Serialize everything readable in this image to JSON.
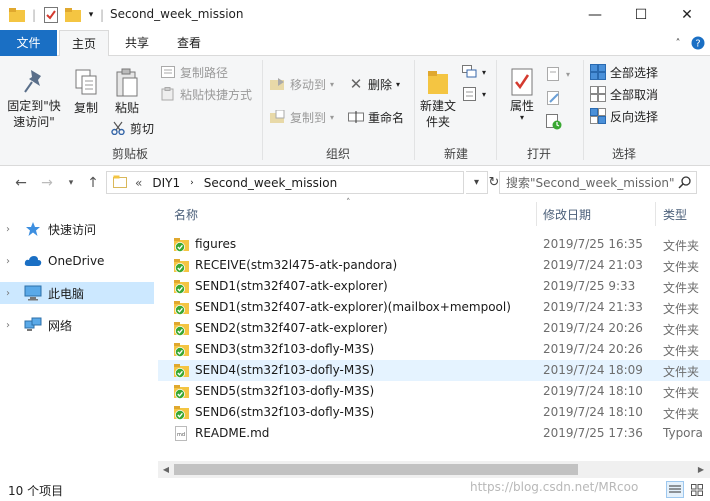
{
  "window": {
    "title": "Second_week_mission",
    "minimize": "—",
    "maximize": "☐",
    "close": "✕"
  },
  "tabs": {
    "file": "文件",
    "home": "主页",
    "share": "共享",
    "view": "查看"
  },
  "ribbon": {
    "clipboard": {
      "label": "剪贴板",
      "pin": "固定到\"快速访问\"",
      "copy": "复制",
      "paste": "粘贴",
      "copy_path": "复制路径",
      "paste_shortcut": "粘贴快捷方式",
      "cut": "剪切"
    },
    "organize": {
      "label": "组织",
      "move_to": "移动到",
      "copy_to": "复制到",
      "delete": "删除",
      "rename": "重命名"
    },
    "new": {
      "label": "新建",
      "new_folder": "新建文件夹"
    },
    "open": {
      "label": "打开",
      "properties": "属性"
    },
    "select": {
      "label": "选择",
      "select_all": "全部选择",
      "select_none": "全部取消",
      "invert": "反向选择"
    }
  },
  "address": {
    "prefix": "«",
    "segments": [
      "DIY1",
      "Second_week_mission"
    ],
    "search_placeholder": "搜索\"Second_week_mission\""
  },
  "nav": {
    "items": [
      {
        "label": "快速访问",
        "icon": "star-icon"
      },
      {
        "label": "OneDrive",
        "icon": "cloud-icon"
      },
      {
        "label": "此电脑",
        "icon": "computer-icon",
        "selected": true
      },
      {
        "label": "网络",
        "icon": "network-icon"
      }
    ]
  },
  "columns": {
    "name": "名称",
    "date": "修改日期",
    "type": "类型"
  },
  "files": [
    {
      "name": "figures",
      "date": "2019/7/25 16:35",
      "type": "文件夹",
      "kind": "folder"
    },
    {
      "name": "RECEIVE(stm32l475-atk-pandora)",
      "date": "2019/7/24 21:03",
      "type": "文件夹",
      "kind": "folder"
    },
    {
      "name": "SEND1(stm32f407-atk-explorer)",
      "date": "2019/7/25 9:33",
      "type": "文件夹",
      "kind": "folder"
    },
    {
      "name": "SEND1(stm32f407-atk-explorer)(mailbox+mempool)",
      "date": "2019/7/24 21:33",
      "type": "文件夹",
      "kind": "folder"
    },
    {
      "name": "SEND2(stm32f407-atk-explorer)",
      "date": "2019/7/24 20:26",
      "type": "文件夹",
      "kind": "folder"
    },
    {
      "name": "SEND3(stm32f103-dofly-M3S)",
      "date": "2019/7/24 20:26",
      "type": "文件夹",
      "kind": "folder"
    },
    {
      "name": "SEND4(stm32f103-dofly-M3S)",
      "date": "2019/7/24 18:09",
      "type": "文件夹",
      "kind": "folder",
      "hover": true
    },
    {
      "name": "SEND5(stm32f103-dofly-M3S)",
      "date": "2019/7/24 18:10",
      "type": "文件夹",
      "kind": "folder"
    },
    {
      "name": "SEND6(stm32f103-dofly-M3S)",
      "date": "2019/7/24 18:10",
      "type": "文件夹",
      "kind": "folder"
    },
    {
      "name": "README.md",
      "date": "2019/7/25 17:36",
      "type": "Typora",
      "kind": "md"
    }
  ],
  "status": {
    "count": "10 个项目",
    "watermark": "https://blog.csdn.net/MRcoo"
  },
  "colors": {
    "accent": "#1a6fc4",
    "selection": "#cce8ff",
    "hover": "#e5f3ff",
    "folder": "#f4c542",
    "sync_badge": "#3aa832"
  }
}
